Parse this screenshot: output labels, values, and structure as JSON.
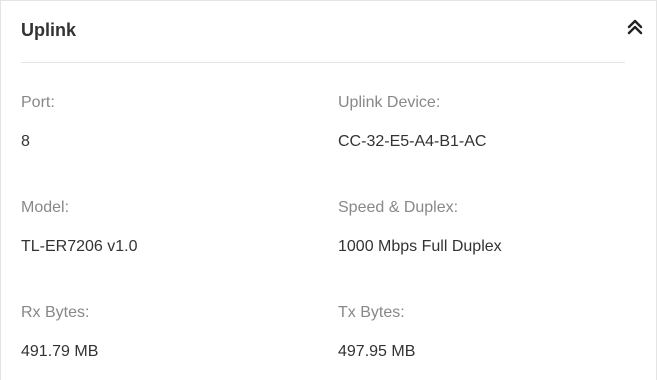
{
  "panel": {
    "title": "Uplink",
    "collapse_icon": "double-chevron-up-icon"
  },
  "fields": {
    "port": {
      "label": "Port:",
      "value": "8"
    },
    "uplink_device": {
      "label": "Uplink Device:",
      "value": "CC-32-E5-A4-B1-AC"
    },
    "model": {
      "label": "Model:",
      "value": "TL-ER7206 v1.0"
    },
    "speed_duplex": {
      "label": "Speed & Duplex:",
      "value": "1000 Mbps Full Duplex"
    },
    "rx_bytes": {
      "label": "Rx Bytes:",
      "value": "491.79 MB"
    },
    "tx_bytes": {
      "label": "Tx Bytes:",
      "value": "497.95 MB"
    }
  },
  "colors": {
    "title_text": "#333333",
    "label_text": "#888888",
    "value_text": "#333333",
    "divider": "#e4e4e4"
  }
}
